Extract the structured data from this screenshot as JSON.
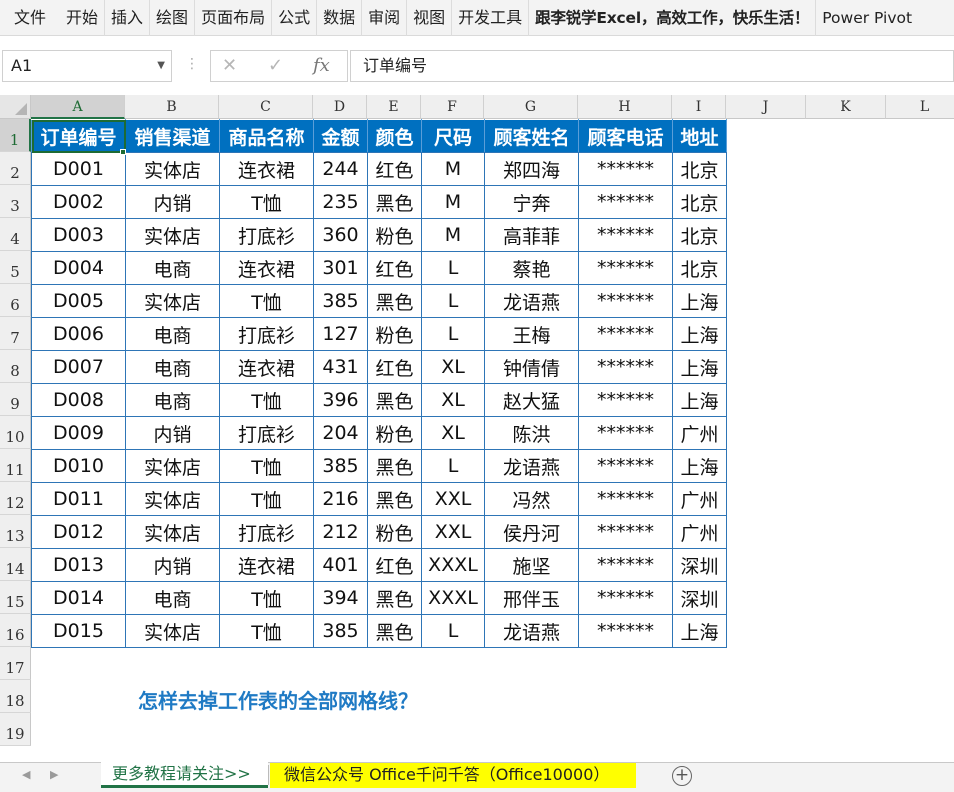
{
  "ribbon": {
    "tabs": [
      "文件",
      "开始",
      "插入",
      "绘图",
      "页面布局",
      "公式",
      "数据",
      "审阅",
      "视图",
      "开发工具"
    ],
    "custom_tab": "跟李锐学Excel，高效工作，快乐生活！",
    "power_pivot": "Power Pivot"
  },
  "formula_bar": {
    "name_box": "A1",
    "cancel_icon": "✕",
    "enter_icon": "✓",
    "fx_label": "fx",
    "content": "订单编号"
  },
  "columns": [
    "A",
    "B",
    "C",
    "D",
    "E",
    "F",
    "G",
    "H",
    "I",
    "J",
    "K",
    "L"
  ],
  "rows": [
    "1",
    "2",
    "3",
    "4",
    "5",
    "6",
    "7",
    "8",
    "9",
    "10",
    "11",
    "12",
    "13",
    "14",
    "15",
    "16",
    "17",
    "18",
    "19"
  ],
  "table": {
    "headers": [
      "订单编号",
      "销售渠道",
      "商品名称",
      "金额",
      "颜色",
      "尺码",
      "顾客姓名",
      "顾客电话",
      "地址"
    ],
    "rows": [
      [
        "D001",
        "实体店",
        "连衣裙",
        "244",
        "红色",
        "M",
        "郑四海",
        "******",
        "北京"
      ],
      [
        "D002",
        "内销",
        "T恤",
        "235",
        "黑色",
        "M",
        "宁奔",
        "******",
        "北京"
      ],
      [
        "D003",
        "实体店",
        "打底衫",
        "360",
        "粉色",
        "M",
        "高菲菲",
        "******",
        "北京"
      ],
      [
        "D004",
        "电商",
        "连衣裙",
        "301",
        "红色",
        "L",
        "蔡艳",
        "******",
        "北京"
      ],
      [
        "D005",
        "实体店",
        "T恤",
        "385",
        "黑色",
        "L",
        "龙语燕",
        "******",
        "上海"
      ],
      [
        "D006",
        "电商",
        "打底衫",
        "127",
        "粉色",
        "L",
        "王梅",
        "******",
        "上海"
      ],
      [
        "D007",
        "电商",
        "连衣裙",
        "431",
        "红色",
        "XL",
        "钟倩倩",
        "******",
        "上海"
      ],
      [
        "D008",
        "电商",
        "T恤",
        "396",
        "黑色",
        "XL",
        "赵大猛",
        "******",
        "上海"
      ],
      [
        "D009",
        "内销",
        "打底衫",
        "204",
        "粉色",
        "XL",
        "陈洪",
        "******",
        "广州"
      ],
      [
        "D010",
        "实体店",
        "T恤",
        "385",
        "黑色",
        "L",
        "龙语燕",
        "******",
        "上海"
      ],
      [
        "D011",
        "实体店",
        "T恤",
        "216",
        "黑色",
        "XXL",
        "冯然",
        "******",
        "广州"
      ],
      [
        "D012",
        "实体店",
        "打底衫",
        "212",
        "粉色",
        "XXL",
        "侯丹河",
        "******",
        "广州"
      ],
      [
        "D013",
        "内销",
        "连衣裙",
        "401",
        "红色",
        "XXXL",
        "施坚",
        "******",
        "深圳"
      ],
      [
        "D014",
        "电商",
        "T恤",
        "394",
        "黑色",
        "XXXL",
        "邢伴玉",
        "******",
        "深圳"
      ],
      [
        "D015",
        "实体店",
        "T恤",
        "385",
        "黑色",
        "L",
        "龙语燕",
        "******",
        "上海"
      ]
    ]
  },
  "note": "怎样去掉工作表的全部网格线？",
  "sheets": {
    "nav_left": "◀",
    "nav_right": "▶",
    "tab1": "更多教程请关注>>",
    "tab2": "微信公众号 Office千问千答（Office10000）",
    "add": "+"
  },
  "colors": {
    "header_bg": "#0070c0",
    "table_border": "#2e75b6",
    "note_text": "#1f7ac4",
    "sheet2_bg": "#ffff00",
    "accent": "#217346"
  }
}
